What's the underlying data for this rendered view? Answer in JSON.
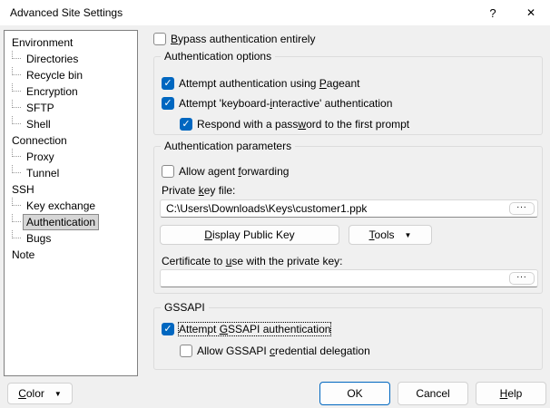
{
  "colors": {
    "accent": "#0067c0",
    "titlebar_bg": "#ffffff",
    "dialog_bg": "#f0f0f0",
    "tree_selected_bg": "#d6d6d6"
  },
  "glyphs": {
    "check": "✓",
    "dropdown": "▼",
    "browse": "...",
    "help": "?",
    "close": "✕"
  },
  "window": {
    "title": "Advanced Site Settings"
  },
  "tree": {
    "items": [
      {
        "label": "Environment",
        "level": 0,
        "selected": false
      },
      {
        "label": "Directories",
        "level": 1,
        "selected": false
      },
      {
        "label": "Recycle bin",
        "level": 1,
        "selected": false
      },
      {
        "label": "Encryption",
        "level": 1,
        "selected": false
      },
      {
        "label": "SFTP",
        "level": 1,
        "selected": false
      },
      {
        "label": "Shell",
        "level": 1,
        "selected": false
      },
      {
        "label": "Connection",
        "level": 0,
        "selected": false
      },
      {
        "label": "Proxy",
        "level": 1,
        "selected": false
      },
      {
        "label": "Tunnel",
        "level": 1,
        "selected": false
      },
      {
        "label": "SSH",
        "level": 0,
        "selected": false
      },
      {
        "label": "Key exchange",
        "level": 1,
        "selected": false
      },
      {
        "label": "Authentication",
        "level": 1,
        "selected": true
      },
      {
        "label": "Bugs",
        "level": 1,
        "selected": false
      },
      {
        "label": "Note",
        "level": 0,
        "selected": false
      }
    ]
  },
  "main": {
    "bypass": {
      "pre": "",
      "mn": "B",
      "post": "ypass authentication entirely",
      "checked": false
    },
    "auth_options": {
      "title": "Authentication options",
      "pageant": {
        "pre": "Attempt authentication using ",
        "mn": "P",
        "post": "ageant",
        "checked": true
      },
      "keyboard": {
        "pre": "Attempt 'keyboard-",
        "mn": "i",
        "post": "nteractive' authentication",
        "checked": true
      },
      "respond": {
        "pre": "Respond with a pass",
        "mn": "w",
        "post": "ord to the first prompt",
        "checked": true
      }
    },
    "auth_params": {
      "title": "Authentication parameters",
      "agent": {
        "pre": "Allow agent ",
        "mn": "f",
        "post": "orwarding",
        "checked": false
      },
      "private_key": {
        "label": {
          "pre": "Private ",
          "mn": "k",
          "post": "ey file:"
        },
        "value": "C:\\Users\\Downloads\\Keys\\customer1.ppk"
      },
      "display_public_key": {
        "pre": "",
        "mn": "D",
        "post": "isplay Public Key"
      },
      "tools": {
        "pre": "",
        "mn": "T",
        "post": "ools"
      },
      "certificate": {
        "label": {
          "pre": "Certificate to ",
          "mn": "u",
          "post": "se with the private key:"
        },
        "value": ""
      }
    },
    "gssapi": {
      "title": "GSSAPI",
      "attempt": {
        "pre": "Attempt ",
        "mn": "G",
        "post": "SSAPI authentication",
        "checked": true
      },
      "delegation": {
        "pre": "Allow GSSAPI ",
        "mn": "c",
        "post": "redential delegation",
        "checked": false
      }
    }
  },
  "footer": {
    "color": {
      "pre": "",
      "mn": "C",
      "post": "olor"
    },
    "ok": "OK",
    "cancel": "Cancel",
    "help": {
      "pre": "",
      "mn": "H",
      "post": "elp"
    }
  }
}
